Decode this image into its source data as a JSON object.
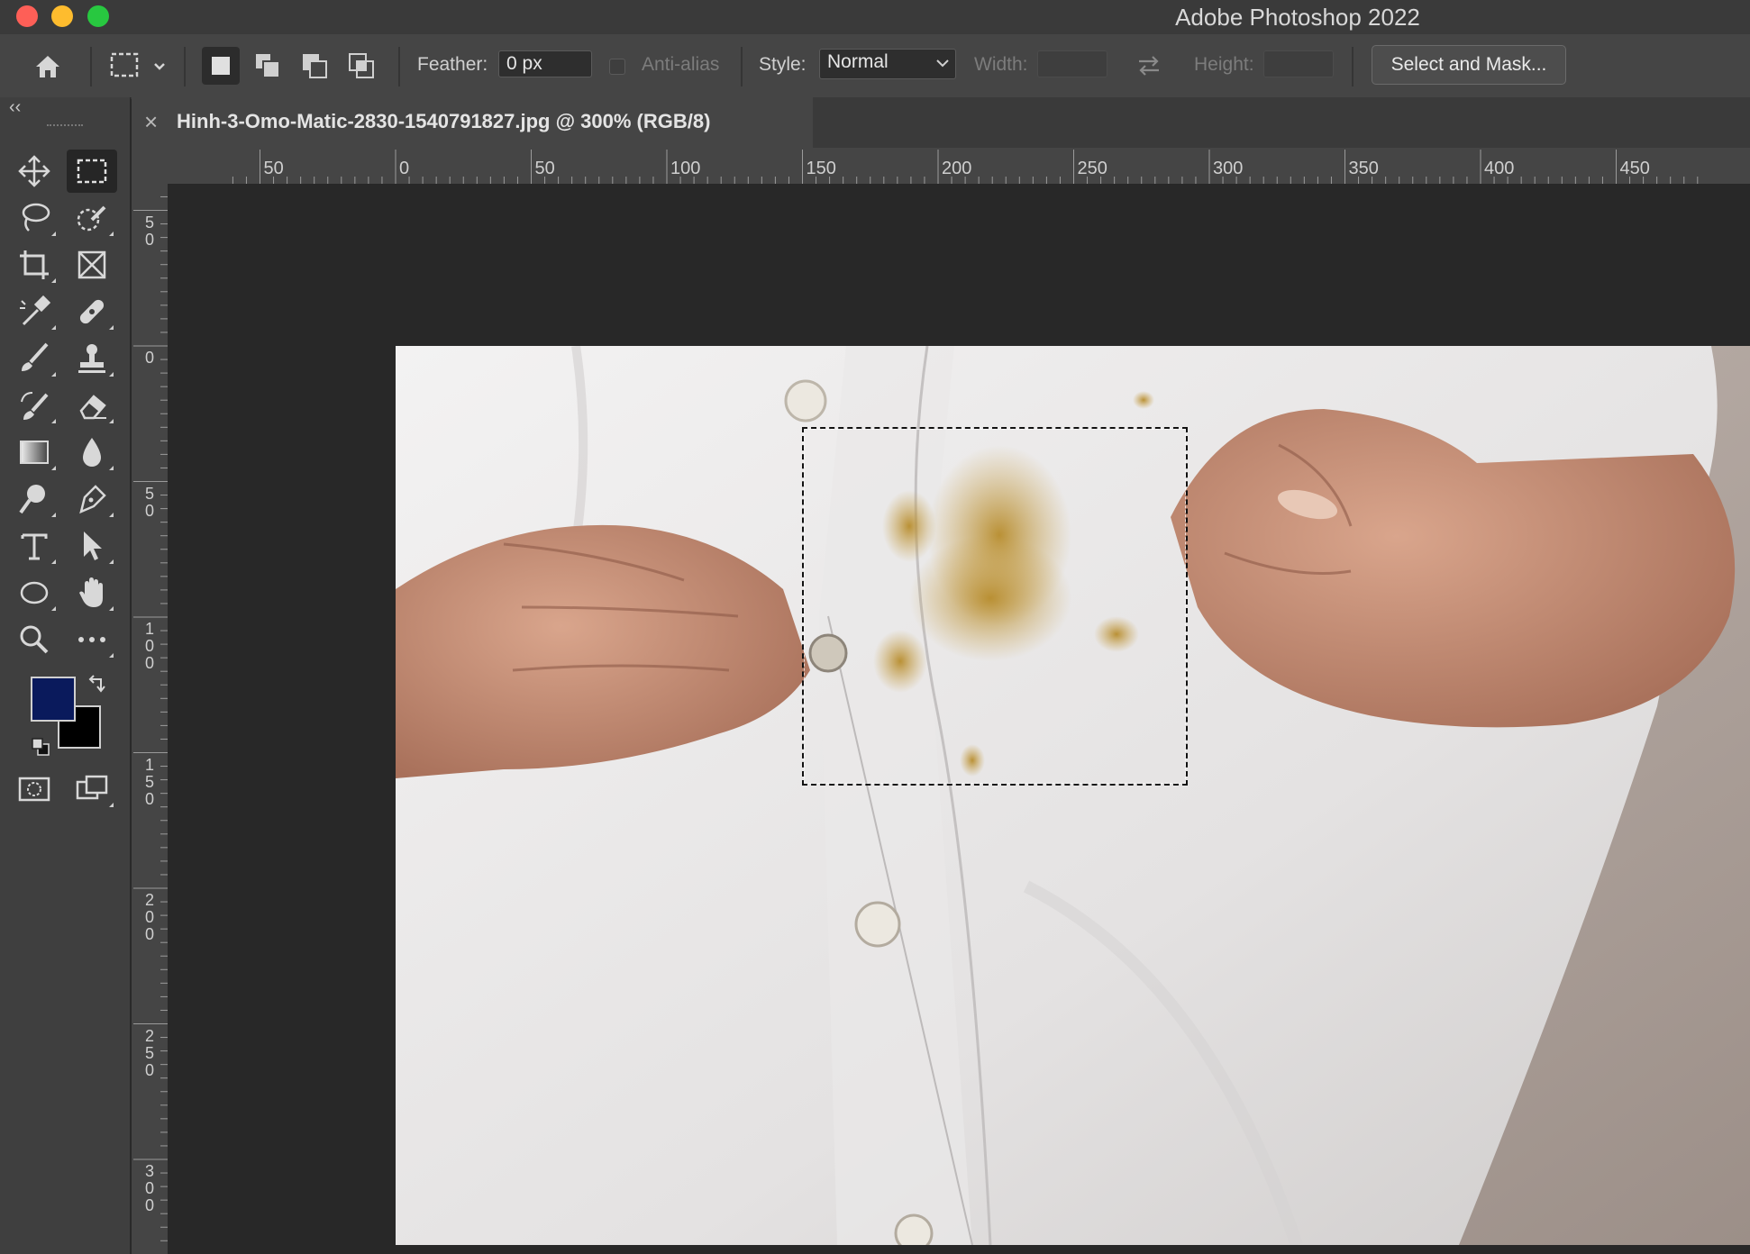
{
  "window": {
    "title": "Adobe Photoshop 2022",
    "controls": {
      "close_color": "#fe5f57",
      "minimize_color": "#febc2e",
      "zoom_color": "#28c840"
    }
  },
  "options_bar": {
    "feather_label": "Feather:",
    "feather_value": "0 px",
    "anti_alias_label": "Anti-alias",
    "style_label": "Style:",
    "style_value": "Normal",
    "width_label": "Width:",
    "height_label": "Height:",
    "select_and_mask_label": "Select and Mask..."
  },
  "toolbar": {
    "collapse_glyph": "‹‹",
    "foreground_color": "#0a1a5c",
    "background_color": "#000000",
    "tools": [
      "move-tool",
      "rectangular-marquee-tool",
      "lasso-tool",
      "quick-selection-tool",
      "crop-tool",
      "frame-tool",
      "eyedropper-tool",
      "spot-healing-tool",
      "brush-tool",
      "clone-stamp-tool",
      "history-brush-tool",
      "eraser-tool",
      "gradient-tool",
      "blur-tool",
      "dodge-tool",
      "pen-tool",
      "type-tool",
      "path-selection-tool",
      "ellipse-tool",
      "hand-tool",
      "zoom-tool",
      "edit-toolbar-tool",
      "quick-mask-mode",
      "screen-mode"
    ],
    "active_tool": "rectangular-marquee-tool"
  },
  "document": {
    "tab_title": "Hinh-3-Omo-Matic-2830-1540791827.jpg @ 300% (RGB/8)",
    "close_glyph": "×"
  },
  "rulers": {
    "horizontal_labels": [
      "50",
      "0",
      "50",
      "100",
      "150",
      "200",
      "250",
      "300",
      "350",
      "400",
      "450"
    ],
    "vertical_labels": [
      "50",
      "0",
      "50",
      "100",
      "150",
      "200",
      "250",
      "300"
    ]
  }
}
